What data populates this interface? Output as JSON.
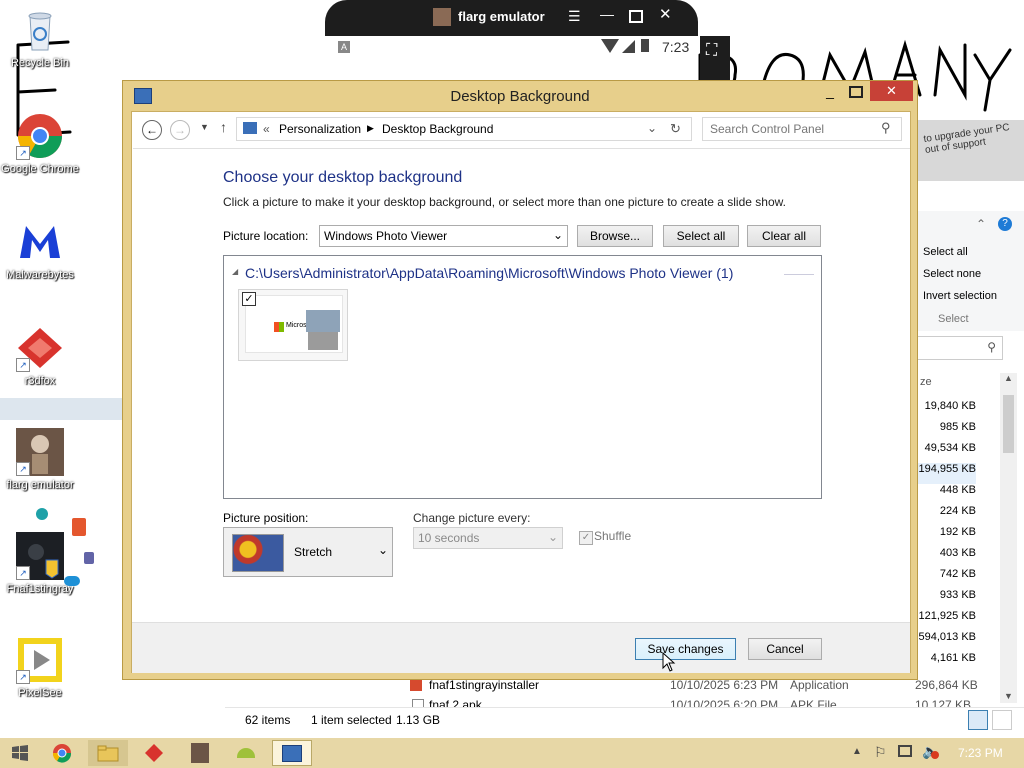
{
  "desktop": {
    "icons": [
      {
        "label": "Recycle Bin"
      },
      {
        "label": "Google Chrome"
      },
      {
        "label": "Malwarebytes"
      },
      {
        "label": "r3dfox"
      },
      {
        "label": "flarg emulator"
      },
      {
        "label": "Fnaf1stingray"
      },
      {
        "label": "PixelSee"
      }
    ],
    "wallpaper_text": "FLARG COMPANY"
  },
  "emulator": {
    "title": "flarg emulator",
    "time": "7:23",
    "badge": "A"
  },
  "dialog": {
    "title": "Desktop Background",
    "breadcrumb": {
      "prefix": "«",
      "items": [
        "Personalization",
        "Desktop Background"
      ]
    },
    "search_placeholder": "Search Control Panel",
    "heading": "Choose your desktop background",
    "description": "Click a picture to make it your desktop background, or select more than one picture to create a slide show.",
    "picture_location_label": "Picture location:",
    "picture_location_value": "Windows Photo Viewer",
    "browse_label": "Browse...",
    "select_all_label": "Select all",
    "clear_all_label": "Clear all",
    "group_header": "C:\\Users\\Administrator\\AppData\\Roaming\\Microsoft\\Windows Photo Viewer (1)",
    "thumbnail_text": "Microsoft",
    "thumbnail_checked": true,
    "picture_position_label": "Picture position:",
    "picture_position_value": "Stretch",
    "change_every_label": "Change picture every:",
    "change_every_value": "10 seconds",
    "shuffle_label": "Shuffle",
    "shuffle_checked": true,
    "save_label": "Save changes",
    "cancel_label": "Cancel"
  },
  "explorer": {
    "ribbon": [
      "Select all",
      "Select none",
      "Invert selection"
    ],
    "ribbon_group": "Select",
    "column_header": "ze",
    "sizes": [
      "19,840 KB",
      "985 KB",
      "49,534 KB",
      "194,955 KB",
      "448 KB",
      "224 KB",
      "192 KB",
      "403 KB",
      "742 KB",
      "933 KB",
      "121,925 KB",
      "594,013 KB",
      "4,161 KB",
      "296,864 KB",
      "10,127 KB"
    ],
    "rows": [
      {
        "name": "fnaf1stingrayinstaller",
        "date": "10/10/2025 6:23 PM",
        "type": "Application",
        "size": "296,864 KB"
      },
      {
        "name": "fnaf 2.apk",
        "date": "10/10/2025 6:20 PM",
        "type": "APK File",
        "size": "10,127 KB"
      }
    ],
    "status": {
      "items": "62 items",
      "selected": "1 item selected",
      "size": "1.13 GB"
    }
  },
  "taskbar": {
    "time": "7:23 PM"
  },
  "colors": {
    "dialog_frame": "#e7cf8b",
    "close_red": "#c74137",
    "heading_blue": "#1e3287",
    "taskbar": "#e7d7a6"
  }
}
